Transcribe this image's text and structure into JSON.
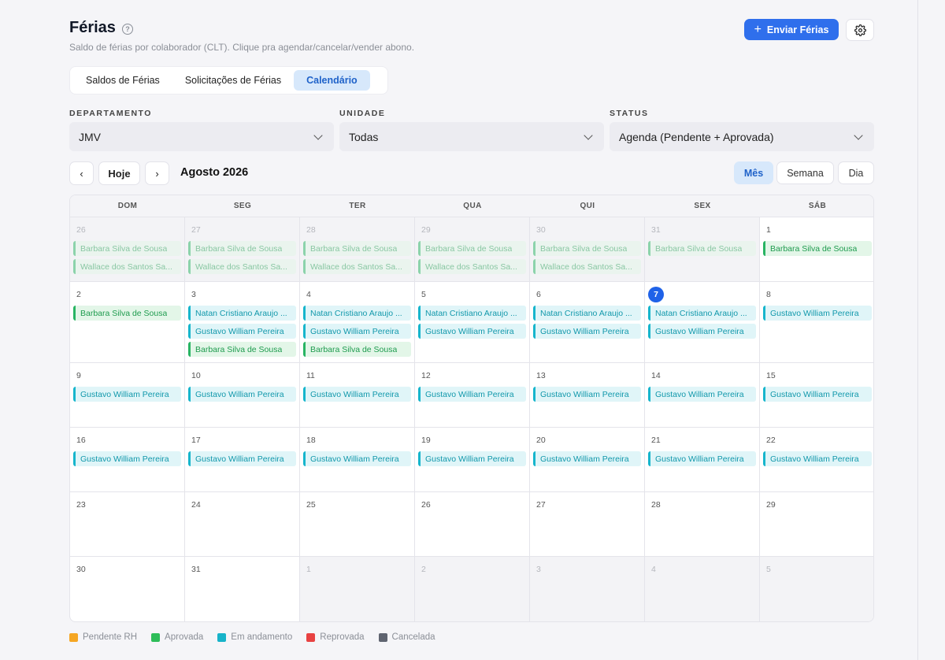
{
  "header": {
    "title": "Férias",
    "subtitle": "Saldo de férias por colaborador (CLT). Clique pra agendar/cancelar/vender abono.",
    "send_button": "Enviar Férias",
    "help_icon": "question-circle-icon",
    "settings_icon": "gear-icon"
  },
  "tabs": [
    "Saldos de Férias",
    "Solicitações de Férias",
    "Calendário"
  ],
  "active_tab": 2,
  "filters": {
    "departamento": {
      "label": "DEPARTAMENTO",
      "value": "JMV"
    },
    "unidade": {
      "label": "UNIDADE",
      "value": "Todas"
    },
    "status": {
      "label": "STATUS",
      "value": "Agenda (Pendente + Aprovada)"
    }
  },
  "toolbar": {
    "prev": "‹",
    "today": "Hoje",
    "next": "›",
    "month_title": "Agosto 2026",
    "views": [
      "Mês",
      "Semana",
      "Dia"
    ],
    "active_view": 0
  },
  "colors": {
    "accent": "#2f6fec",
    "approved": "#28b463",
    "in_progress": "#16b5cc"
  },
  "calendar": {
    "weekdays": [
      "DOM",
      "SEG",
      "TER",
      "QUA",
      "QUI",
      "SEX",
      "SÁB"
    ],
    "weeks": [
      [
        {
          "day": "26",
          "outside": true,
          "events": [
            {
              "text": "Barbara Silva de Sousa",
              "kind": "green"
            },
            {
              "text": "Wallace dos Santos Sa...",
              "kind": "green"
            }
          ]
        },
        {
          "day": "27",
          "outside": true,
          "events": [
            {
              "text": "Barbara Silva de Sousa",
              "kind": "green"
            },
            {
              "text": "Wallace dos Santos Sa...",
              "kind": "green"
            }
          ]
        },
        {
          "day": "28",
          "outside": true,
          "events": [
            {
              "text": "Barbara Silva de Sousa",
              "kind": "green"
            },
            {
              "text": "Wallace dos Santos Sa...",
              "kind": "green"
            }
          ]
        },
        {
          "day": "29",
          "outside": true,
          "events": [
            {
              "text": "Barbara Silva de Sousa",
              "kind": "green"
            },
            {
              "text": "Wallace dos Santos Sa...",
              "kind": "green"
            }
          ]
        },
        {
          "day": "30",
          "outside": true,
          "events": [
            {
              "text": "Barbara Silva de Sousa",
              "kind": "green"
            },
            {
              "text": "Wallace dos Santos Sa...",
              "kind": "green"
            }
          ]
        },
        {
          "day": "31",
          "outside": true,
          "events": [
            {
              "text": "Barbara Silva de Sousa",
              "kind": "green"
            }
          ]
        },
        {
          "day": "1",
          "outside": false,
          "events": [
            {
              "text": "Barbara Silva de Sousa",
              "kind": "green"
            }
          ]
        }
      ],
      [
        {
          "day": "2",
          "outside": false,
          "events": [
            {
              "text": "Barbara Silva de Sousa",
              "kind": "green"
            }
          ]
        },
        {
          "day": "3",
          "outside": false,
          "events": [
            {
              "text": "Natan Cristiano Araujo ...",
              "kind": "teal"
            },
            {
              "text": "Gustavo William Pereira",
              "kind": "teal"
            },
            {
              "text": "Barbara Silva de Sousa",
              "kind": "green"
            }
          ]
        },
        {
          "day": "4",
          "outside": false,
          "events": [
            {
              "text": "Natan Cristiano Araujo ...",
              "kind": "teal"
            },
            {
              "text": "Gustavo William Pereira",
              "kind": "teal"
            },
            {
              "text": "Barbara Silva de Sousa",
              "kind": "green"
            }
          ]
        },
        {
          "day": "5",
          "outside": false,
          "events": [
            {
              "text": "Natan Cristiano Araujo ...",
              "kind": "teal"
            },
            {
              "text": "Gustavo William Pereira",
              "kind": "teal"
            }
          ]
        },
        {
          "day": "6",
          "outside": false,
          "events": [
            {
              "text": "Natan Cristiano Araujo ...",
              "kind": "teal"
            },
            {
              "text": "Gustavo William Pereira",
              "kind": "teal"
            }
          ]
        },
        {
          "day": "7",
          "outside": false,
          "today": true,
          "events": [
            {
              "text": "Natan Cristiano Araujo ...",
              "kind": "teal"
            },
            {
              "text": "Gustavo William Pereira",
              "kind": "teal"
            }
          ]
        },
        {
          "day": "8",
          "outside": false,
          "events": [
            {
              "text": "Gustavo William Pereira",
              "kind": "teal"
            }
          ]
        }
      ],
      [
        {
          "day": "9",
          "outside": false,
          "events": [
            {
              "text": "Gustavo William Pereira",
              "kind": "teal"
            }
          ]
        },
        {
          "day": "10",
          "outside": false,
          "events": [
            {
              "text": "Gustavo William Pereira",
              "kind": "teal"
            }
          ]
        },
        {
          "day": "11",
          "outside": false,
          "events": [
            {
              "text": "Gustavo William Pereira",
              "kind": "teal"
            }
          ]
        },
        {
          "day": "12",
          "outside": false,
          "events": [
            {
              "text": "Gustavo William Pereira",
              "kind": "teal"
            }
          ]
        },
        {
          "day": "13",
          "outside": false,
          "events": [
            {
              "text": "Gustavo William Pereira",
              "kind": "teal"
            }
          ]
        },
        {
          "day": "14",
          "outside": false,
          "events": [
            {
              "text": "Gustavo William Pereira",
              "kind": "teal"
            }
          ]
        },
        {
          "day": "15",
          "outside": false,
          "events": [
            {
              "text": "Gustavo William Pereira",
              "kind": "teal"
            }
          ]
        }
      ],
      [
        {
          "day": "16",
          "outside": false,
          "events": [
            {
              "text": "Gustavo William Pereira",
              "kind": "teal"
            }
          ]
        },
        {
          "day": "17",
          "outside": false,
          "events": [
            {
              "text": "Gustavo William Pereira",
              "kind": "teal"
            }
          ]
        },
        {
          "day": "18",
          "outside": false,
          "events": [
            {
              "text": "Gustavo William Pereira",
              "kind": "teal"
            }
          ]
        },
        {
          "day": "19",
          "outside": false,
          "events": [
            {
              "text": "Gustavo William Pereira",
              "kind": "teal"
            }
          ]
        },
        {
          "day": "20",
          "outside": false,
          "events": [
            {
              "text": "Gustavo William Pereira",
              "kind": "teal"
            }
          ]
        },
        {
          "day": "21",
          "outside": false,
          "events": [
            {
              "text": "Gustavo William Pereira",
              "kind": "teal"
            }
          ]
        },
        {
          "day": "22",
          "outside": false,
          "events": [
            {
              "text": "Gustavo William Pereira",
              "kind": "teal"
            }
          ]
        }
      ],
      [
        {
          "day": "23",
          "outside": false,
          "events": []
        },
        {
          "day": "24",
          "outside": false,
          "events": []
        },
        {
          "day": "25",
          "outside": false,
          "events": []
        },
        {
          "day": "26",
          "outside": false,
          "events": []
        },
        {
          "day": "27",
          "outside": false,
          "events": []
        },
        {
          "day": "28",
          "outside": false,
          "events": []
        },
        {
          "day": "29",
          "outside": false,
          "events": []
        }
      ],
      [
        {
          "day": "30",
          "outside": false,
          "events": []
        },
        {
          "day": "31",
          "outside": false,
          "events": []
        },
        {
          "day": "1",
          "outside": true,
          "events": []
        },
        {
          "day": "2",
          "outside": true,
          "events": []
        },
        {
          "day": "3",
          "outside": true,
          "events": []
        },
        {
          "day": "4",
          "outside": true,
          "events": []
        },
        {
          "day": "5",
          "outside": true,
          "events": []
        }
      ]
    ]
  },
  "legend": [
    {
      "label": "Pendente RH",
      "color": "#f5a623"
    },
    {
      "label": "Aprovada",
      "color": "#2ebd59"
    },
    {
      "label": "Em andamento",
      "color": "#17b3c9"
    },
    {
      "label": "Reprovada",
      "color": "#e84242"
    },
    {
      "label": "Cancelada",
      "color": "#5f6470"
    }
  ]
}
